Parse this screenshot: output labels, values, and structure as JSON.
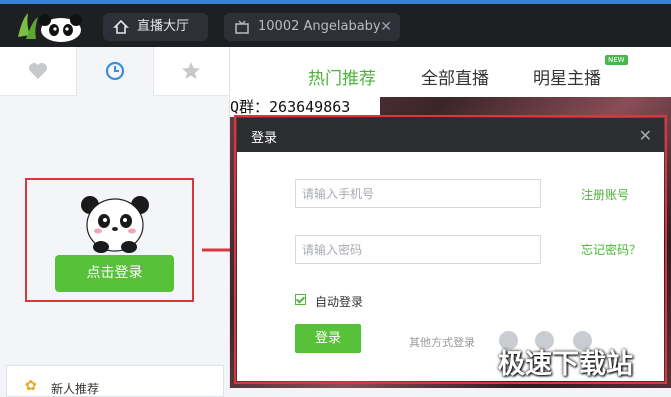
{
  "app": {
    "brand_color": "#58c13a",
    "accent_red": "#d9363e"
  },
  "tabs": [
    {
      "label": "直播大厅",
      "icon": "home-icon"
    },
    {
      "label": "10002 Angelababy",
      "icon": "tv-icon",
      "close": "✕"
    }
  ],
  "left_panel": {
    "tabs": [
      {
        "name": "favorites",
        "icon": "heart-icon"
      },
      {
        "name": "history",
        "icon": "clock-icon",
        "active": true
      },
      {
        "name": "star",
        "icon": "star-icon"
      }
    ],
    "login_button": "点击登录",
    "new_recommend": "新人推荐"
  },
  "nav": {
    "hot": "热门推荐",
    "all": "全部直播",
    "star": "明星主播",
    "new_badge": "NEW"
  },
  "video": {
    "qq_group": "Q群：263649863"
  },
  "dialog": {
    "title": "登录",
    "close": "✕",
    "phone_placeholder": "请输入手机号",
    "password_placeholder": "请输入密码",
    "register_link": "注册账号",
    "forgot_link": "忘记密码？",
    "auto_login": "自动登录",
    "auto_login_checked": true,
    "login_button": "登录",
    "other_methods": "其他方式登录"
  },
  "watermark": "极速下载站"
}
